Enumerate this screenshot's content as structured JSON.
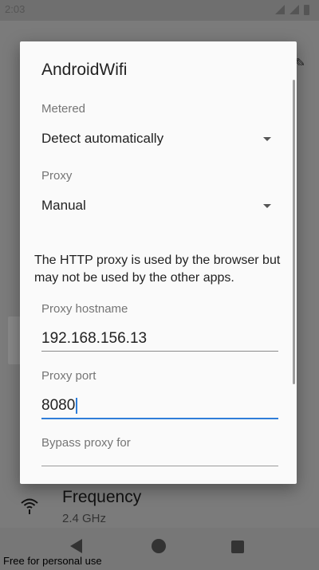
{
  "background": {
    "status_time": "2:03",
    "rows": [
      {
        "title": "Frequency",
        "sub": "2.4 GHz",
        "icon": "wifi-icon"
      }
    ]
  },
  "dialog": {
    "title": "AndroidWifi",
    "metered": {
      "label": "Metered",
      "value": "Detect automatically"
    },
    "proxy": {
      "label": "Proxy",
      "value": "Manual"
    },
    "info_text": "The HTTP proxy is used by the browser but may not be used by the other apps.",
    "proxy_hostname": {
      "label": "Proxy hostname",
      "value": "192.168.156.13"
    },
    "proxy_port": {
      "label": "Proxy port",
      "value": "8080"
    },
    "bypass_proxy": {
      "label": "Bypass proxy for"
    }
  },
  "footer": {
    "watermark": "Free for personal use"
  },
  "colors": {
    "accent": "#2f7dd8",
    "scrim": "#7b7b7b"
  }
}
